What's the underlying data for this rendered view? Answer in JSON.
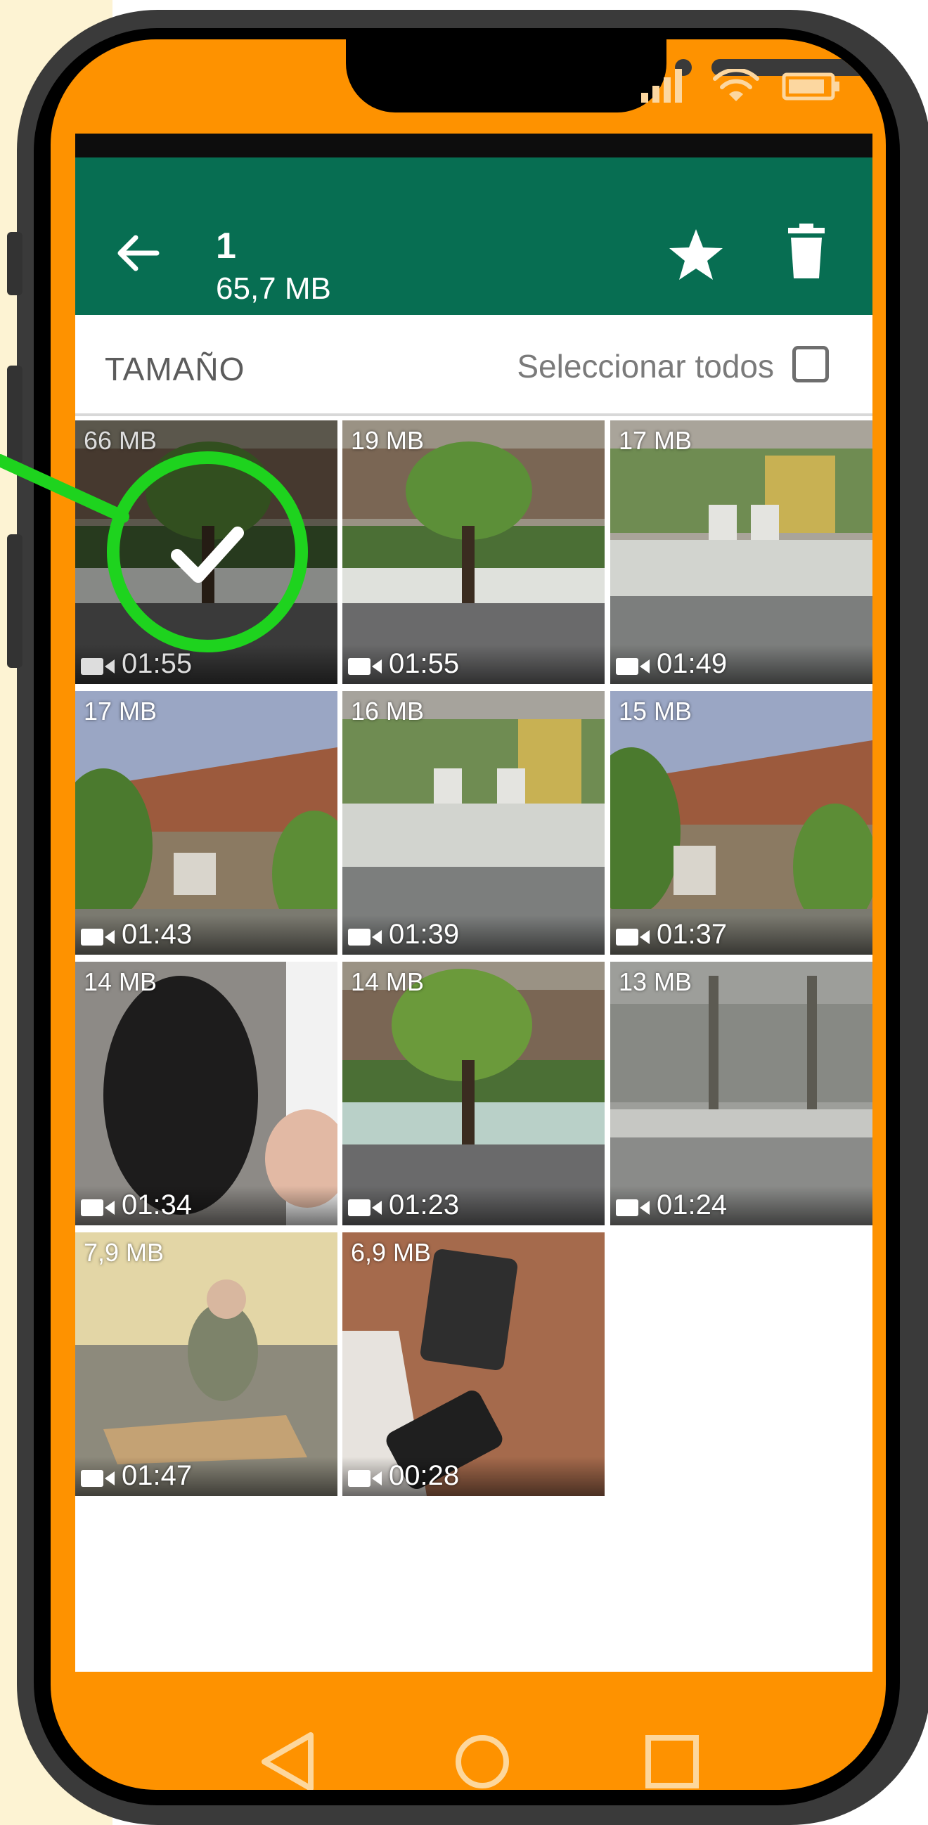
{
  "header": {
    "count": "1",
    "size": "65,7 MB"
  },
  "toolbar": {
    "sort_label": "TAMAÑO",
    "select_all_label": "Seleccionar todos"
  },
  "videos": [
    {
      "size": "66 MB",
      "duration": "01:55",
      "selected": true
    },
    {
      "size": "19 MB",
      "duration": "01:55"
    },
    {
      "size": "17 MB",
      "duration": "01:49"
    },
    {
      "size": "17 MB",
      "duration": "01:43"
    },
    {
      "size": "16 MB",
      "duration": "01:39"
    },
    {
      "size": "15 MB",
      "duration": "01:37"
    },
    {
      "size": "14 MB",
      "duration": "01:34"
    },
    {
      "size": "14 MB",
      "duration": "01:23"
    },
    {
      "size": "13 MB",
      "duration": "01:24"
    },
    {
      "size": "7,9 MB",
      "duration": "01:47"
    },
    {
      "size": "6,9 MB",
      "duration": "00:28"
    }
  ],
  "colors": {
    "app_bar": "#076e52",
    "phone_accent": "#fe9200",
    "highlight": "#1ed31e"
  },
  "icons": [
    "back-arrow-icon",
    "star-icon",
    "trash-icon",
    "checkbox-icon",
    "video-camera-icon",
    "check-icon",
    "signal-icon",
    "wifi-icon",
    "battery-icon",
    "nav-back-icon",
    "nav-home-icon",
    "nav-recents-icon"
  ]
}
